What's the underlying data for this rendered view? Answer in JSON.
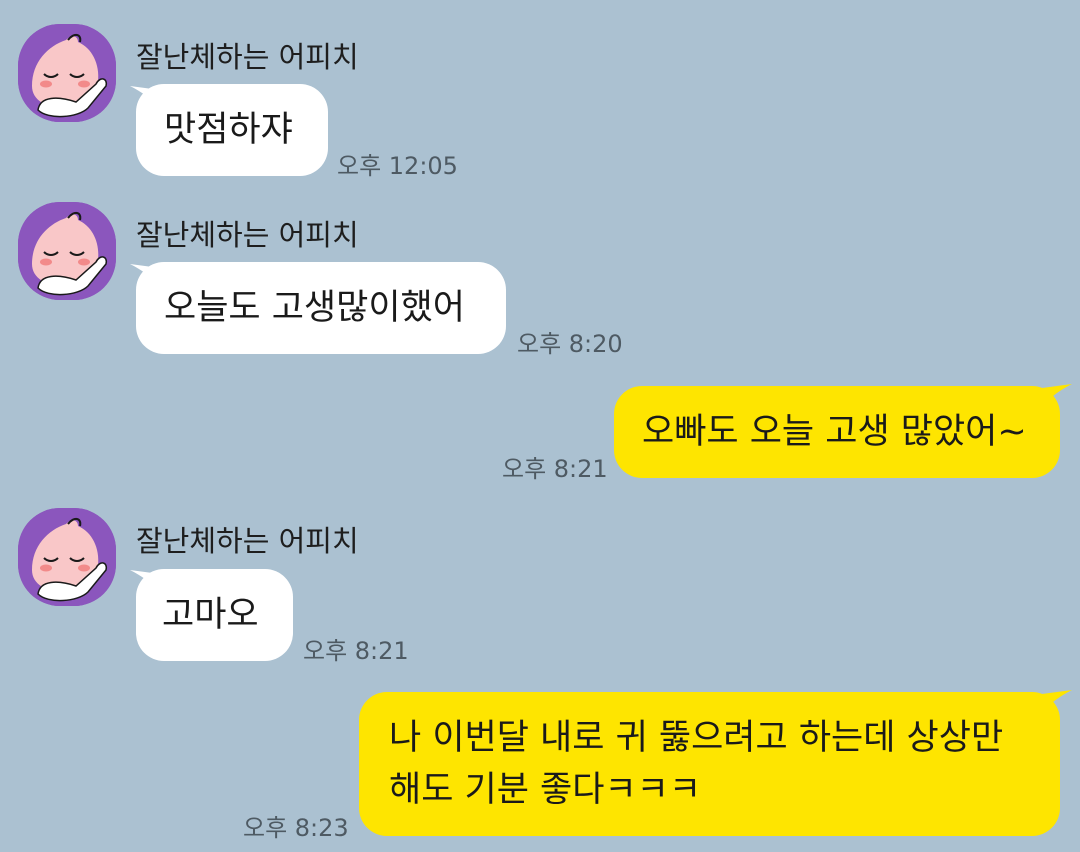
{
  "chat": {
    "messages": [
      {
        "sender": "잘난체하는 어피치",
        "text": "맛점하쟈",
        "time": "오후 12:05"
      },
      {
        "sender": "잘난체하는 어피치",
        "text": "오늘도 고생많이했어",
        "time": "오후 8:20"
      },
      {
        "text": "오빠도 오늘 고생 많았어~",
        "time": "오후 8:21"
      },
      {
        "sender": "잘난체하는 어피치",
        "text": "고마오",
        "time": "오후 8:21"
      },
      {
        "text_line1": "나 이번달 내로 귀 뚫으려고 하는데 상상만",
        "text_line2": "해도 기분 좋다ㅋㅋㅋ",
        "time": "오후 8:23"
      }
    ]
  },
  "colors": {
    "background": "#abc1d1",
    "incoming_bubble": "#ffffff",
    "outgoing_bubble": "#fee500",
    "avatar_bg": "#8b56bd"
  },
  "icons": {
    "avatar": "apeach-avatar-icon"
  }
}
